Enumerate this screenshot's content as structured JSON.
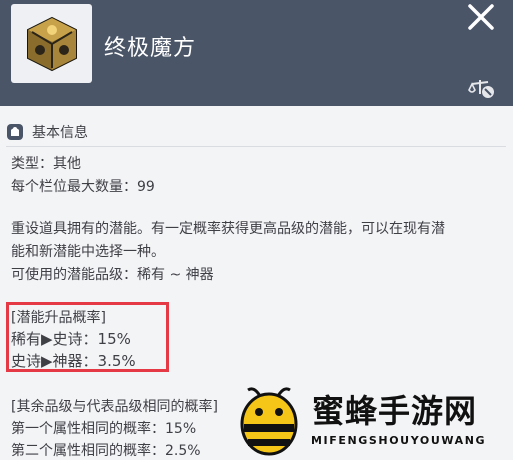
{
  "header": {
    "title": "终极魔方",
    "close_icon": "close-icon",
    "compare_icon": "scale-compare-icon",
    "background": "#4a5568"
  },
  "section": {
    "icon": "bag-icon",
    "label": "基本信息"
  },
  "info": {
    "type": "类型：其他",
    "max_per_slot": "每个栏位最大数量：99",
    "desc_line1": "重设道具拥有的潜能。有一定概率获得更高品级的潜能，可以在现有潜",
    "desc_line2": "能和新潜能中选择一种。",
    "usable_grades": "可使用的潜能品级：稀有 ~ 神器"
  },
  "upgrade": {
    "heading": "[潜能升品概率]",
    "rare_to_epic": "稀有▶史诗：15%",
    "epic_to_legend": "史诗▶神器：3.5%",
    "highlight_color": "#e53945"
  },
  "same_grade": {
    "heading": "[其余品级与代表品级相同的概率]",
    "first": "第一个属性相同的概率：15%",
    "second": "第二个属性相同的概率：2.5%"
  },
  "watermark": {
    "title": "蜜蜂手游网",
    "subtitle": "MIFENGSHOUYOUWANG",
    "icon": "bee-logo-icon"
  }
}
